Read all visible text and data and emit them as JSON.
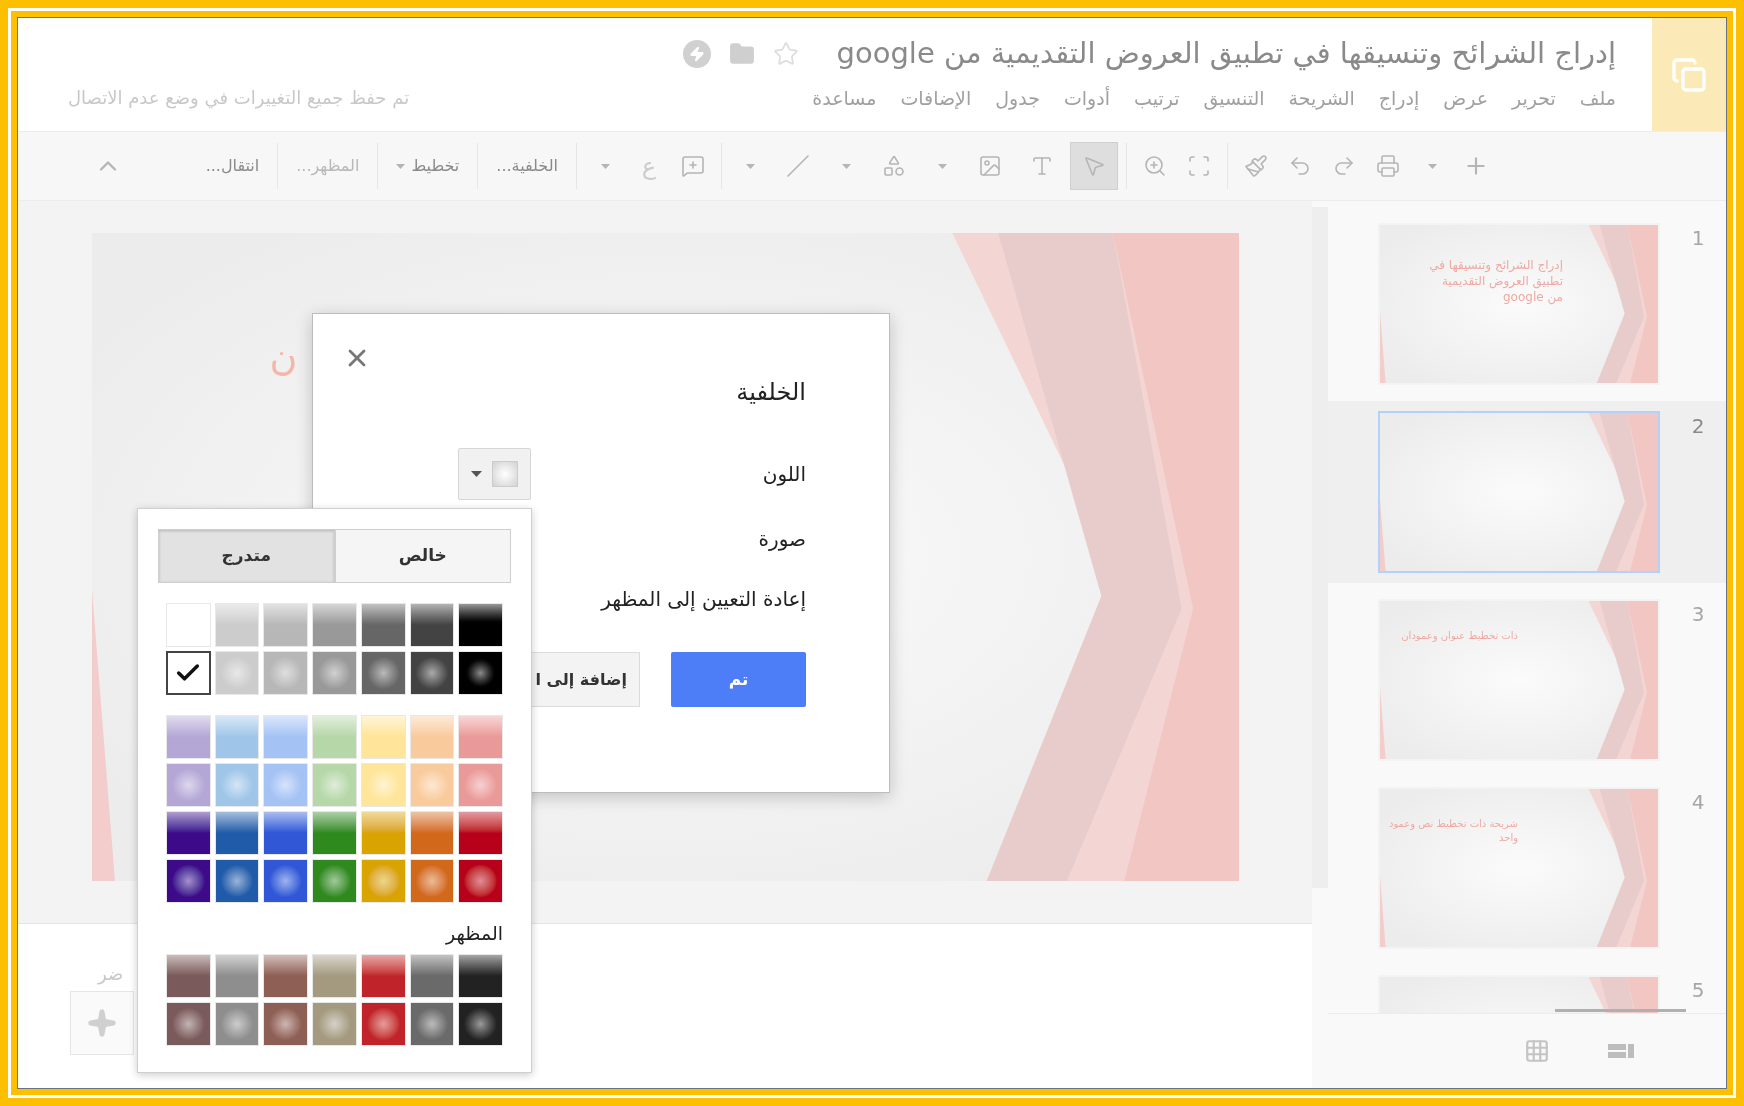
{
  "header": {
    "title": "إدراج الشرائح وتنسيقها في تطبيق العروض التقديمية من google",
    "menu": [
      "ملف",
      "تحرير",
      "عرض",
      "إدراج",
      "الشريحة",
      "التنسيق",
      "ترتيب",
      "أدوات",
      "جدول",
      "الإضافات",
      "مساعدة"
    ],
    "save_status": "تم حفظ جميع التغييرات في وضع عدم الاتصال"
  },
  "toolbar": {
    "tools": [
      {
        "kind": "select",
        "selected": true,
        "dropdown": false
      },
      {
        "kind": "textbox",
        "selected": false,
        "dropdown": false
      },
      {
        "kind": "image",
        "selected": false,
        "dropdown": true
      },
      {
        "kind": "shape",
        "selected": false,
        "dropdown": true
      },
      {
        "kind": "line",
        "selected": false,
        "dropdown": true
      }
    ],
    "input_tools": "ع",
    "buttons": [
      {
        "label": "الخلفية...",
        "dropdown": false,
        "disabled": false
      },
      {
        "label": "تخطيط",
        "dropdown": true,
        "disabled": false
      },
      {
        "label": "المظهر...",
        "dropdown": false,
        "disabled": true
      },
      {
        "label": "انتقال...",
        "dropdown": false,
        "disabled": false
      }
    ]
  },
  "slide": {
    "text": "ن"
  },
  "notes": {
    "text": "ضر"
  },
  "filmstrip": [
    {
      "number": "1",
      "selected": false,
      "title": "إدراج الشرائح وتنسيقها في تطبيق العروض التقديمية من google"
    },
    {
      "number": "2",
      "selected": true
    },
    {
      "number": "3",
      "selected": false,
      "title": "ذات تخطيط عنوان وعمودان"
    },
    {
      "number": "4",
      "selected": false,
      "title": "شريحة ذات تخطيط نص وعمود واحد"
    },
    {
      "number": "5",
      "selected": false
    }
  ],
  "dialog": {
    "title": "الخلفية",
    "rows": [
      "اللون",
      "صورة",
      "إعادة التعيين إلى المظهر"
    ],
    "primary_button": "تم",
    "secondary_button": "إضافة إلى ا"
  },
  "picker": {
    "tabs": [
      {
        "label": "خالص",
        "selected": false
      },
      {
        "label": "متدرج",
        "selected": true
      }
    ],
    "sections": [
      {
        "rows": [
          {
            "kind": "linear",
            "swatches": [
              {
                "color": "#ffffff",
                "selected": false
              },
              {
                "color": "#cccccc",
                "selected": false
              },
              {
                "color": "#b7b7b7",
                "selected": false
              },
              {
                "color": "#999999",
                "selected": false
              },
              {
                "color": "#666666",
                "selected": false
              },
              {
                "color": "#434343",
                "selected": false
              },
              {
                "color": "#000000",
                "selected": false
              }
            ]
          },
          {
            "kind": "radial",
            "swatches": [
              {
                "color": "#ffffff",
                "selected": true
              },
              {
                "color": "#cccccc",
                "selected": false
              },
              {
                "color": "#b7b7b7",
                "selected": false
              },
              {
                "color": "#999999",
                "selected": false
              },
              {
                "color": "#666666",
                "selected": false
              },
              {
                "color": "#434343",
                "selected": false
              },
              {
                "color": "#000000",
                "selected": false
              }
            ]
          }
        ]
      },
      {
        "rows": [
          {
            "kind": "linear",
            "swatches": [
              {
                "color": "#b4a7d6",
                "selected": false
              },
              {
                "color": "#9fc5e8",
                "selected": false
              },
              {
                "color": "#a4c2f4",
                "selected": false
              },
              {
                "color": "#b6d7a8",
                "selected": false
              },
              {
                "color": "#ffe599",
                "selected": false
              },
              {
                "color": "#f9cb9c",
                "selected": false
              },
              {
                "color": "#ea9999",
                "selected": false
              }
            ]
          },
          {
            "kind": "radial",
            "swatches": [
              {
                "color": "#b4a7d6",
                "selected": false
              },
              {
                "color": "#9fc5e8",
                "selected": false
              },
              {
                "color": "#a4c2f4",
                "selected": false
              },
              {
                "color": "#b6d7a8",
                "selected": false
              },
              {
                "color": "#ffe599",
                "selected": false
              },
              {
                "color": "#f9cb9c",
                "selected": false
              },
              {
                "color": "#ea9999",
                "selected": false
              }
            ]
          },
          {
            "kind": "linear",
            "swatches": [
              {
                "color": "#3d0a8a",
                "selected": false
              },
              {
                "color": "#1f5ba8",
                "selected": false
              },
              {
                "color": "#3156d6",
                "selected": false
              },
              {
                "color": "#2f8a1e",
                "selected": false
              },
              {
                "color": "#d9a300",
                "selected": false
              },
              {
                "color": "#d2691a",
                "selected": false
              },
              {
                "color": "#b8001a",
                "selected": false
              }
            ]
          },
          {
            "kind": "radial",
            "swatches": [
              {
                "color": "#3d0a8a",
                "selected": false
              },
              {
                "color": "#1f5ba8",
                "selected": false
              },
              {
                "color": "#3156d6",
                "selected": false
              },
              {
                "color": "#2f8a1e",
                "selected": false
              },
              {
                "color": "#d9a300",
                "selected": false
              },
              {
                "color": "#d2691a",
                "selected": false
              },
              {
                "color": "#b8001a",
                "selected": false
              }
            ]
          }
        ]
      },
      {
        "label": "المظهر",
        "rows": [
          {
            "kind": "linear",
            "swatches": [
              {
                "color": "#7a5a5a",
                "selected": false
              },
              {
                "color": "#8e8e8e",
                "selected": false
              },
              {
                "color": "#8e5f55",
                "selected": false
              },
              {
                "color": "#a49a80",
                "selected": false
              },
              {
                "color": "#c0242a",
                "selected": false
              },
              {
                "color": "#6a6a6a",
                "selected": false
              },
              {
                "color": "#222222",
                "selected": false
              }
            ]
          },
          {
            "kind": "radial",
            "swatches": [
              {
                "color": "#7a5a5a",
                "selected": false
              },
              {
                "color": "#8e8e8e",
                "selected": false
              },
              {
                "color": "#8e5f55",
                "selected": false
              },
              {
                "color": "#a49a80",
                "selected": false
              },
              {
                "color": "#c0242a",
                "selected": false
              },
              {
                "color": "#6a6a6a",
                "selected": false
              },
              {
                "color": "#222222",
                "selected": false
              }
            ]
          }
        ]
      }
    ]
  }
}
